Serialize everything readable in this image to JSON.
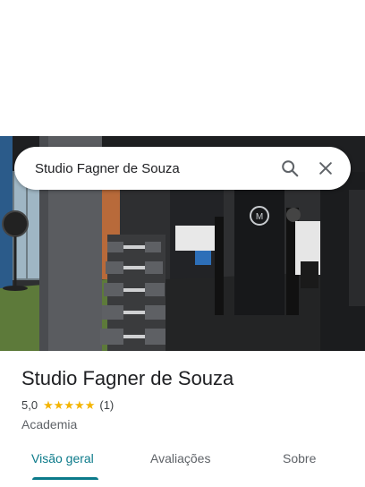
{
  "search": {
    "query": "Studio Fagner de Souza",
    "search_icon": "search-icon",
    "close_icon": "close-icon"
  },
  "photo": {
    "subject": "gym-interior"
  },
  "place": {
    "title": "Studio Fagner de Souza",
    "rating": "5,0",
    "stars": 5,
    "review_count": "(1)",
    "category": "Academia"
  },
  "tabs": [
    {
      "label": "Visão geral",
      "active": true
    },
    {
      "label": "Avaliações",
      "active": false
    },
    {
      "label": "Sobre",
      "active": false
    }
  ],
  "colors": {
    "accent": "#0b7a8a",
    "star": "#f4b400"
  }
}
